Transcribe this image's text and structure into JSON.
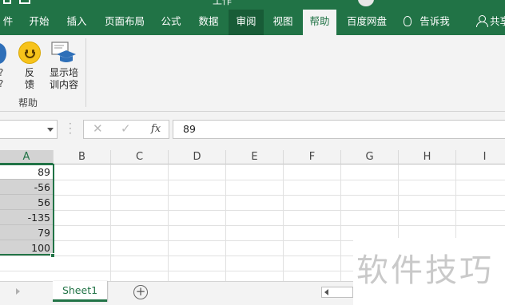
{
  "window": {
    "title_fragment": "工作"
  },
  "ribbon_tabs": [
    {
      "label": "件"
    },
    {
      "label": "开始"
    },
    {
      "label": "插入"
    },
    {
      "label": "页面布局"
    },
    {
      "label": "公式"
    },
    {
      "label": "数据"
    },
    {
      "label": "审阅"
    },
    {
      "label": "视图"
    },
    {
      "label": "帮助"
    },
    {
      "label": "百度网盘"
    },
    {
      "label": "告诉我"
    },
    {
      "label": "共享"
    }
  ],
  "ribbon": {
    "left_partial_labels": [
      "?",
      "?"
    ],
    "feedback_label": "反\n馈",
    "training_label": "显示培\n训内容",
    "group_label": "帮助"
  },
  "formula_bar": {
    "namebox_value": "",
    "cancel_symbol": "✕",
    "enter_symbol": "✓",
    "fx_symbol": "fx",
    "formula_value": "89"
  },
  "columns": [
    "A",
    "B",
    "C",
    "D",
    "E",
    "F",
    "G",
    "H",
    "I"
  ],
  "cells_col_A": [
    "89",
    "-56",
    "56",
    "-135",
    "79",
    "100"
  ],
  "sheet_tabs": {
    "active_sheet": "Sheet1",
    "add_symbol": "+"
  },
  "watermark": "软件技巧",
  "colors": {
    "excel_green": "#217346",
    "selection_gray": "#d3d3d3"
  }
}
